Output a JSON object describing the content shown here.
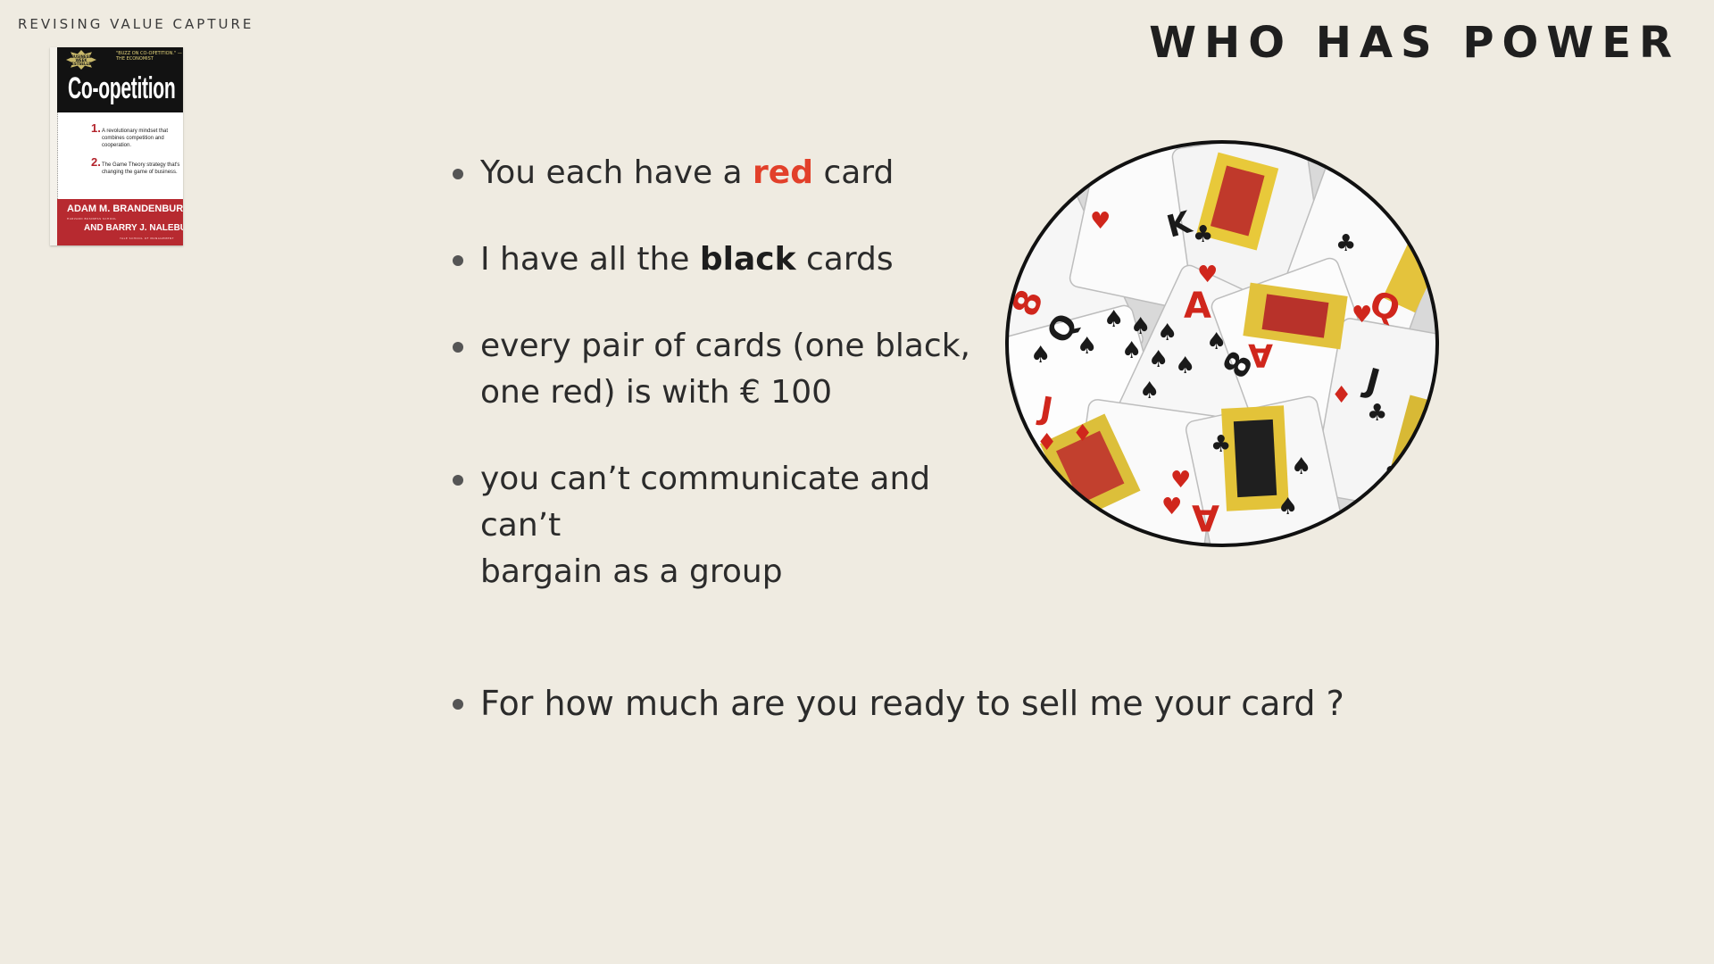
{
  "header": {
    "section_label": "REVISING VALUE CAPTURE",
    "title": "WHO HAS POWER"
  },
  "book": {
    "seal_text": "BUSINESS WEEK BESTSELLER",
    "quote": "\"BUZZ ON CO-OPETITION.\" —THE ECONOMIST",
    "title": "Co-opetition",
    "points": [
      {
        "num": "1.",
        "text": "A revolutionary mindset that combines competition and cooperation."
      },
      {
        "num": "2.",
        "text": "The Game Theory strategy that's changing the game of business."
      }
    ],
    "author1": "ADAM M. BRANDENBURGER",
    "author1_sub": "HARVARD BUSINESS SCHOOL",
    "author2": "AND BARRY J. NALEBUFF",
    "author2_sub": "YALE SCHOOL OF MANAGEMENT"
  },
  "bullets": {
    "b1_pre": "You each have a ",
    "b1_red": "red",
    "b1_post": " card",
    "b2_pre": "I have all the ",
    "b2_bold": "black",
    "b2_post": " cards",
    "b3_line1": "every pair of cards (one black,",
    "b3_line2": "one red) is with € 100",
    "b4_line1": "you can’t communicate and can’t",
    "b4_line2": "bargain as a group"
  },
  "question": "For how much are you ready to sell me your card ?",
  "colors": {
    "background": "#efebe1",
    "accent_red": "#e2402a",
    "text": "#2b2b2b",
    "book_red": "#b72a30"
  }
}
